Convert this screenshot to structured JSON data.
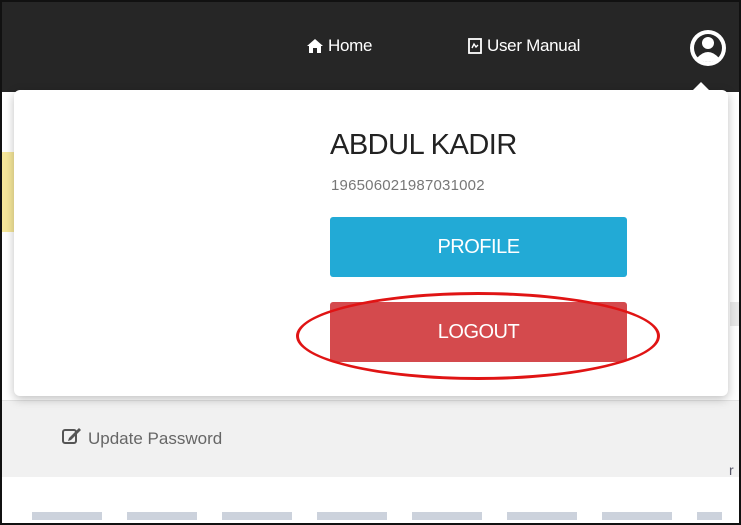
{
  "navbar": {
    "home_label": "Home",
    "home_icon": "home-icon",
    "manual_label": "User Manual",
    "manual_icon": "document-icon",
    "user_icon": "user-circle-icon"
  },
  "dropdown": {
    "user_name": "ABDUL KADIR",
    "user_id": "196506021987031002",
    "profile_label": "PROFILE",
    "logout_label": "LOGOUT"
  },
  "page": {
    "update_password_label": "Update Password",
    "update_password_icon": "edit-icon"
  },
  "colors": {
    "navbar": "#262626",
    "profile_button": "#22aad6",
    "logout_button": "#d44a4d",
    "highlight": "#e01414"
  }
}
